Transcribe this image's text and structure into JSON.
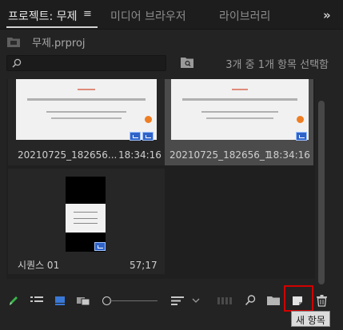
{
  "tabs": [
    {
      "label": "프로젝트: 무제",
      "active": true
    },
    {
      "label": "미디어 브라우저",
      "active": false
    },
    {
      "label": "라이브러리",
      "active": false
    }
  ],
  "tab_menu_glyph": "≡",
  "overflow_glyph": "»",
  "project": {
    "name": "무제.prproj"
  },
  "search": {
    "placeholder": ""
  },
  "selection_status": "3개 중 1개 항목 선택함",
  "clips": [
    {
      "name": "20210725_182656...",
      "duration": "18:34:16",
      "selected": false
    },
    {
      "name": "20210725_182656_1",
      "duration": "18:34:16",
      "selected": true
    },
    {
      "name": "시퀀스 01",
      "duration": "57;17",
      "selected": false
    }
  ],
  "toolbar": {
    "icons": [
      "pencil-icon",
      "list-view-icon",
      "icon-view-icon",
      "freeform-view-icon",
      "zoom-slider",
      "sort-icon",
      "automate-to-sequence-icon",
      "find-icon",
      "new-bin-icon",
      "new-item-icon",
      "clear-icon"
    ]
  },
  "tooltip": {
    "text": "새 항목"
  },
  "colors": {
    "accent": "#2f63c8",
    "highlight_box": "#d10000",
    "pencil": "#39b54a"
  }
}
